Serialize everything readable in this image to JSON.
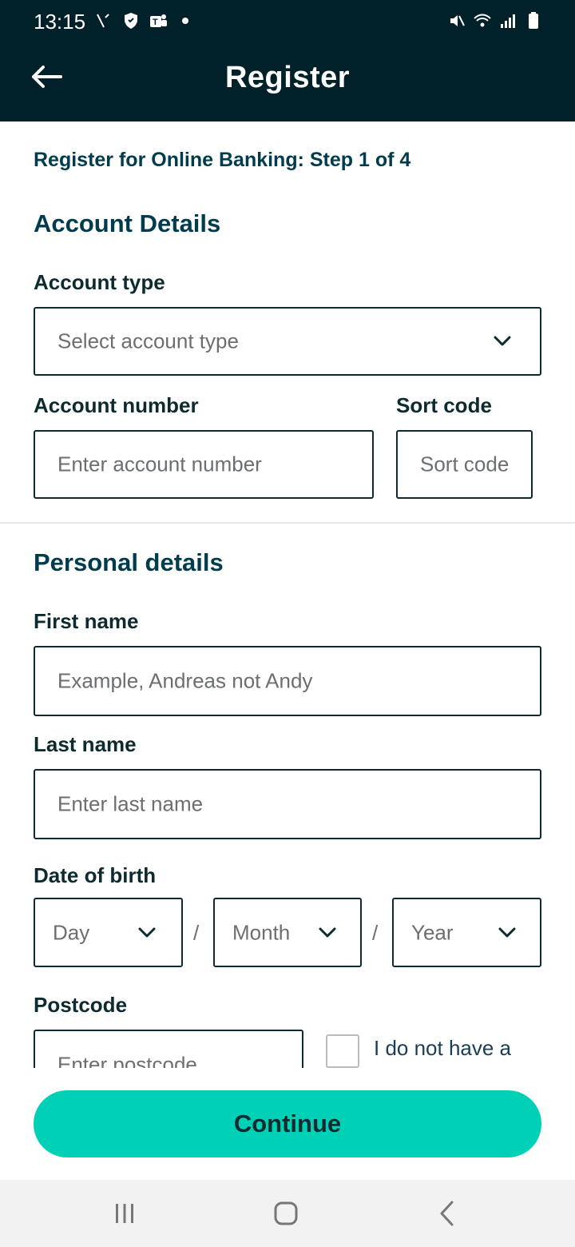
{
  "status_bar": {
    "time": "13:15",
    "left_icons": [
      "signal-slash-icon",
      "shield-icon",
      "teams-icon",
      "dot-icon"
    ],
    "right_icons": [
      "mute-icon",
      "wifi-icon",
      "cell-signal-icon",
      "battery-icon"
    ]
  },
  "app_bar": {
    "back_icon": "arrow-left-icon",
    "title": "Register"
  },
  "form": {
    "step_text": "Register for Online Banking: Step 1 of 4",
    "account_section": {
      "title": "Account Details",
      "account_type": {
        "label": "Account type",
        "placeholder": "Select account type"
      },
      "account_number": {
        "label": "Account number",
        "placeholder": "Enter account number"
      },
      "sort_code": {
        "label": "Sort code",
        "placeholder": "Sort code"
      }
    },
    "personal_section": {
      "title": "Personal details",
      "first_name": {
        "label": "First name",
        "placeholder": "Example, Andreas not Andy"
      },
      "last_name": {
        "label": "Last name",
        "placeholder": "Enter last name"
      },
      "dob": {
        "label": "Date of birth",
        "day_placeholder": "Day",
        "month_placeholder": "Month",
        "year_placeholder": "Year",
        "separator": "/"
      },
      "postcode": {
        "label": "Postcode",
        "placeholder": "Enter postcode",
        "no_postcode_label": "I do not have a"
      }
    }
  },
  "continue_button": {
    "label": "Continue"
  },
  "colors": {
    "header_bg": "#00202a",
    "accent": "#00d0b6",
    "heading": "#003c4d",
    "border": "#0e2a30"
  },
  "nav_bar": {
    "icons": [
      "recents-icon",
      "home-icon",
      "back-nav-icon"
    ]
  }
}
